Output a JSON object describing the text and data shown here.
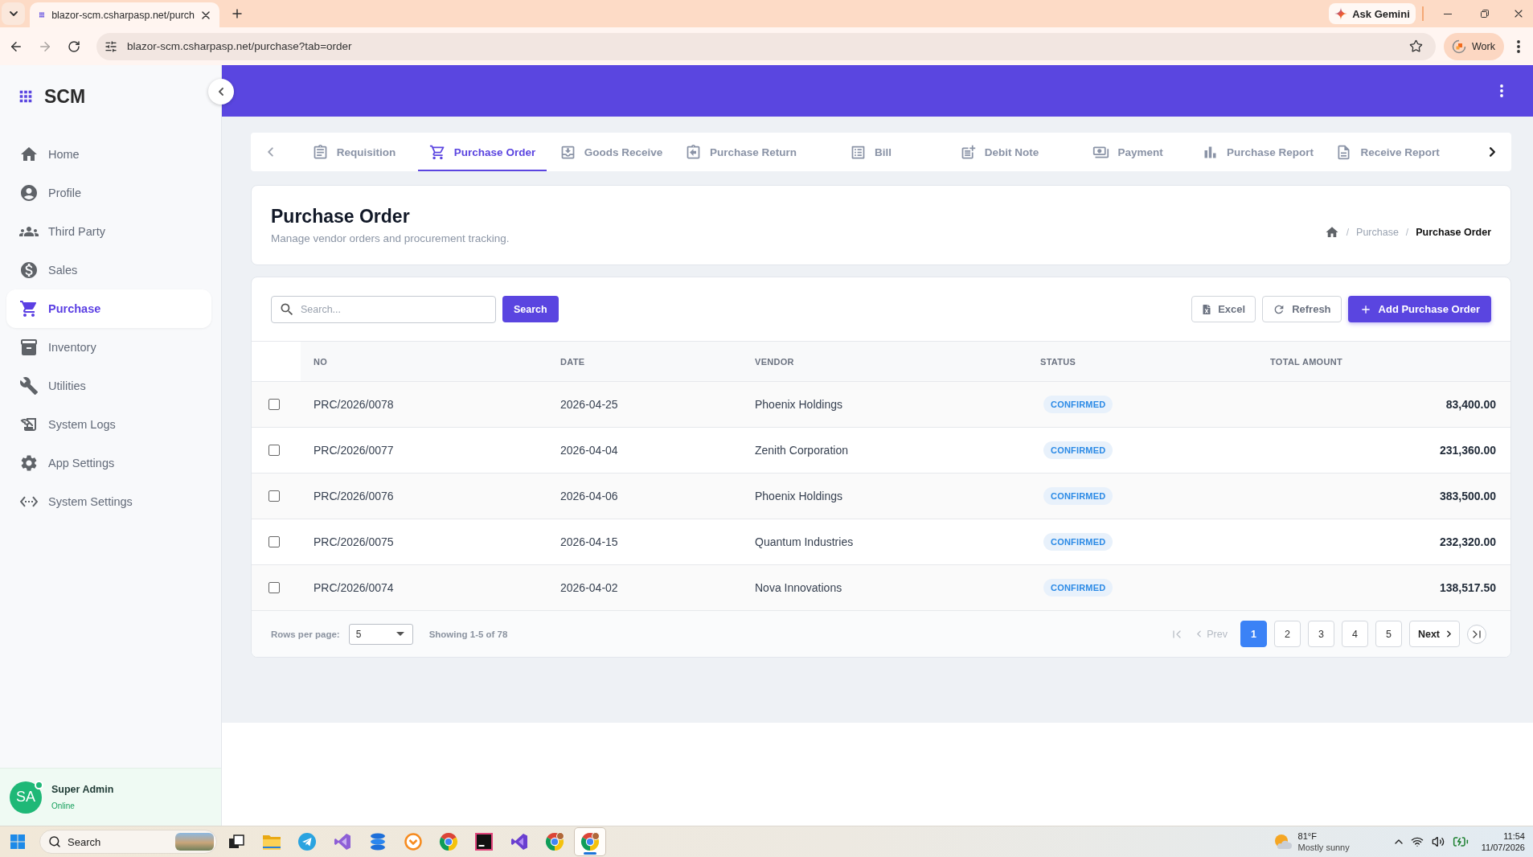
{
  "browser": {
    "tab_title": "blazor-scm.csharpasp.net/purch",
    "url": "blazor-scm.csharpasp.net/purchase?tab=order",
    "gemini_button": "Ask Gemini",
    "profile_button": "Work"
  },
  "sidebar": {
    "logo": "SCM",
    "items": [
      {
        "label": "Home",
        "selected": false
      },
      {
        "label": "Profile",
        "selected": false
      },
      {
        "label": "Third Party",
        "selected": false
      },
      {
        "label": "Sales",
        "selected": false
      },
      {
        "label": "Purchase",
        "selected": true
      },
      {
        "label": "Inventory",
        "selected": false
      },
      {
        "label": "Utilities",
        "selected": false
      },
      {
        "label": "System Logs",
        "selected": false
      },
      {
        "label": "App Settings",
        "selected": false
      },
      {
        "label": "System Settings",
        "selected": false
      }
    ],
    "user": {
      "initials": "SA",
      "name": "Super Admin",
      "status": "Online"
    }
  },
  "module_tabs": [
    {
      "label": "Requisition",
      "selected": false
    },
    {
      "label": "Purchase Order",
      "selected": true
    },
    {
      "label": "Goods Receive",
      "selected": false
    },
    {
      "label": "Purchase Return",
      "selected": false
    },
    {
      "label": "Bill",
      "selected": false
    },
    {
      "label": "Debit Note",
      "selected": false
    },
    {
      "label": "Payment",
      "selected": false
    },
    {
      "label": "Purchase Report",
      "selected": false
    },
    {
      "label": "Receive Report",
      "selected": false
    }
  ],
  "page_header": {
    "title": "Purchase Order",
    "subtitle": "Manage vendor orders and procurement tracking.",
    "breadcrumb": {
      "separator": "/",
      "items": [
        "Purchase",
        "Purchase Order"
      ]
    }
  },
  "toolbar": {
    "search": {
      "placeholder": "Search..."
    },
    "search_button": "Search",
    "actions": [
      {
        "label": "Excel",
        "kind": "outline"
      },
      {
        "label": "Refresh",
        "kind": "outline"
      },
      {
        "label": "Add Purchase Order",
        "kind": "primary"
      }
    ]
  },
  "table": {
    "columns": [
      "NO",
      "DATE",
      "VENDOR",
      "STATUS",
      "TOTAL AMOUNT"
    ],
    "rows": [
      {
        "checked": false,
        "no": "PRC/2026/0078",
        "date": "2026-04-25",
        "vendor": "Phoenix Holdings",
        "status": "CONFIRMED",
        "total": "83,400.00"
      },
      {
        "checked": false,
        "no": "PRC/2026/0077",
        "date": "2026-04-04",
        "vendor": "Zenith Corporation",
        "status": "CONFIRMED",
        "total": "231,360.00"
      },
      {
        "checked": false,
        "no": "PRC/2026/0076",
        "date": "2026-04-06",
        "vendor": "Phoenix Holdings",
        "status": "CONFIRMED",
        "total": "383,500.00"
      },
      {
        "checked": false,
        "no": "PRC/2026/0075",
        "date": "2026-04-15",
        "vendor": "Quantum Industries",
        "status": "CONFIRMED",
        "total": "232,320.00"
      },
      {
        "checked": false,
        "no": "PRC/2026/0074",
        "date": "2026-04-02",
        "vendor": "Nova Innovations",
        "status": "CONFIRMED",
        "total": "138,517.50"
      }
    ]
  },
  "pagination": {
    "rows_per_page_label": "Rows per page:",
    "rows_per_page": "5",
    "summary": "Showing 1-5 of 78",
    "prev": {
      "label": "Prev",
      "disabled": true
    },
    "pages": [
      {
        "label": "1",
        "selected": true
      },
      {
        "label": "2",
        "selected": false
      },
      {
        "label": "3",
        "selected": false
      },
      {
        "label": "4",
        "selected": false
      },
      {
        "label": "5",
        "selected": false
      }
    ],
    "next": {
      "label": "Next",
      "disabled": false
    }
  },
  "taskbar": {
    "search": {
      "placeholder": "Search"
    },
    "apps": [
      {
        "selected": false
      },
      {
        "selected": false
      },
      {
        "selected": false
      },
      {
        "selected": false
      },
      {
        "selected": false
      },
      {
        "selected": false
      },
      {
        "selected": false
      },
      {
        "selected": false
      },
      {
        "selected": false
      },
      {
        "selected": false
      },
      {
        "selected": true
      }
    ],
    "weather": {
      "temperature": "81°F",
      "condition": "Mostly sunny"
    },
    "time": "11:54",
    "date": "11/07/2026"
  }
}
